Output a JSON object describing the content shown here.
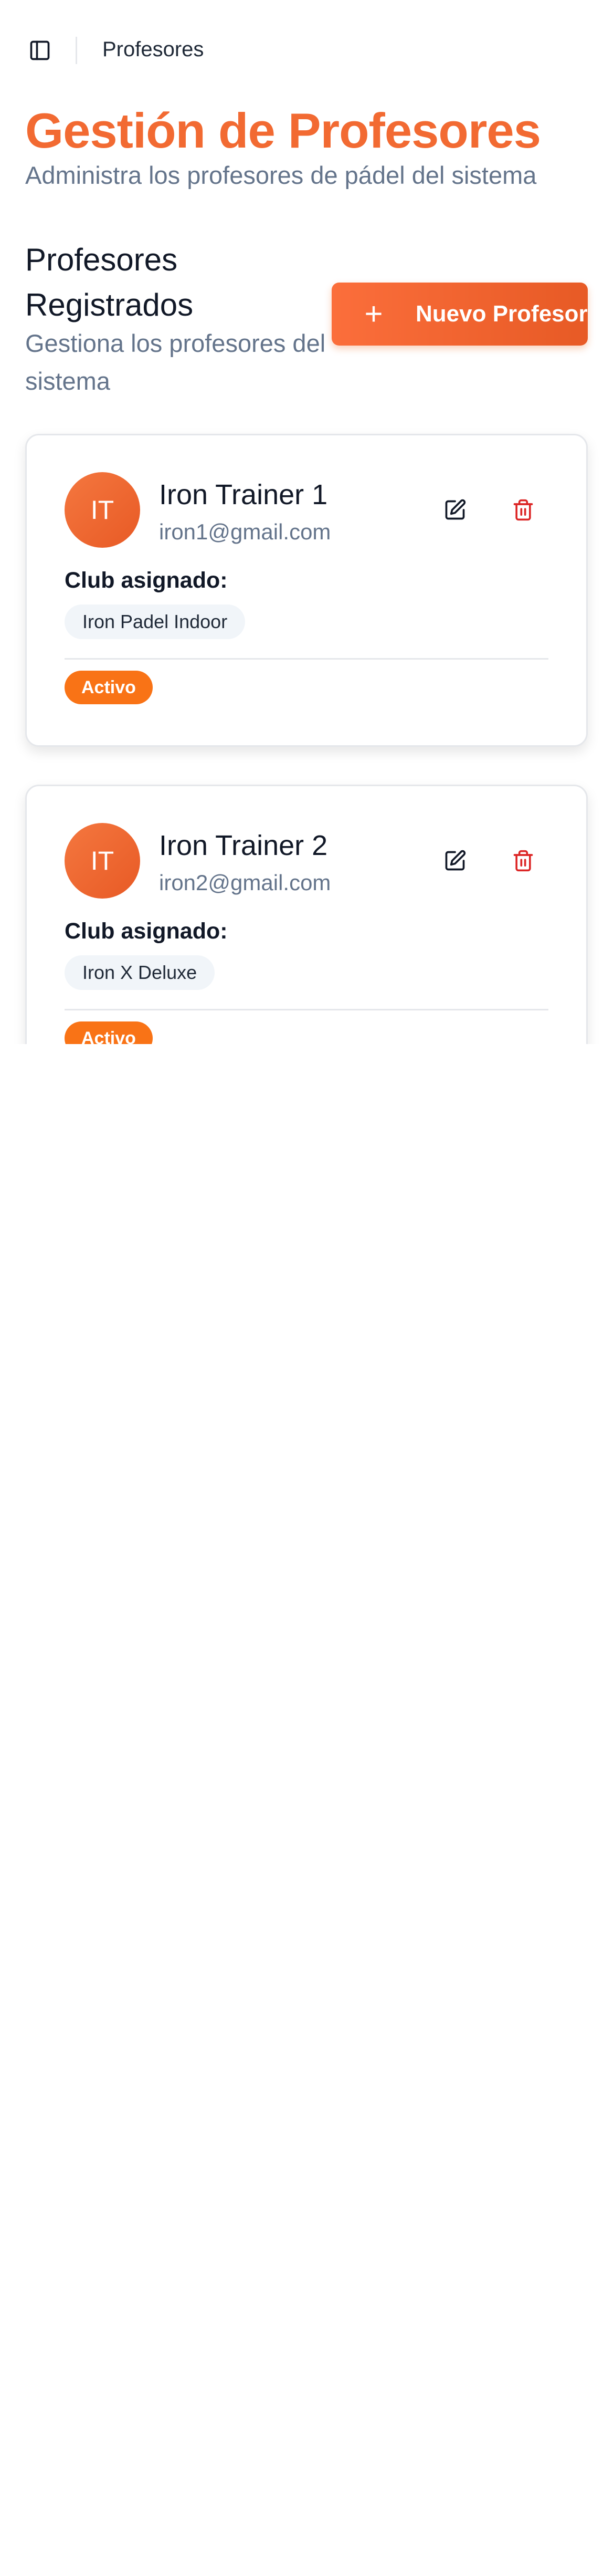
{
  "topbar": {
    "title": "Profesores",
    "toggle_icon": "sidebar-toggle-icon"
  },
  "header": {
    "title": "Gestión de Profesores",
    "subtitle": "Administra los profesores de pádel del sistema"
  },
  "section": {
    "title": "Profesores Registrados",
    "description": "Gestiona los profesores del sistema",
    "new_button": {
      "plus": "+",
      "label": "Nuevo Profesor"
    }
  },
  "professors": [
    {
      "initials": "IT",
      "name": "Iron Trainer 1",
      "email": "iron1@gmail.com",
      "club_label": "Club asignado:",
      "club": "Iron Padel Indoor",
      "status": "Activo"
    },
    {
      "initials": "IT",
      "name": "Iron Trainer 2",
      "email": "iron2@gmail.com",
      "club_label": "Club asignado:",
      "club": "Iron X Deluxe",
      "status": "Activo"
    }
  ],
  "colors": {
    "accent": "#f26a32",
    "muted_text": "#64748b",
    "danger": "#dc2626",
    "status_active": "#f97316"
  }
}
